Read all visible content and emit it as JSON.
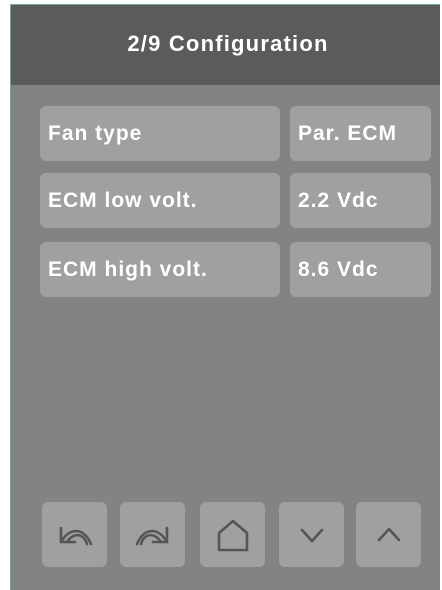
{
  "header": {
    "title": "2/9 Configuration"
  },
  "parameters": [
    {
      "label": "Fan type",
      "value": "Par. ECM"
    },
    {
      "label": "ECM low volt.",
      "value": "2.2 Vdc"
    },
    {
      "label": "ECM high volt.",
      "value": "8.6 Vdc"
    }
  ],
  "nav_buttons": {
    "back_icon": "undo-arrow-icon",
    "forward_icon": "redo-arrow-icon",
    "home_icon": "home-icon",
    "down_icon": "chevron-down-icon",
    "up_icon": "chevron-up-icon"
  },
  "colors": {
    "header_bg": "#5a5b5a",
    "screen_bg": "#838383",
    "box_bg": "#a0a0a0",
    "text": "#ffffff",
    "icon_stroke": "#555555",
    "accent_border": "#6fae93"
  }
}
